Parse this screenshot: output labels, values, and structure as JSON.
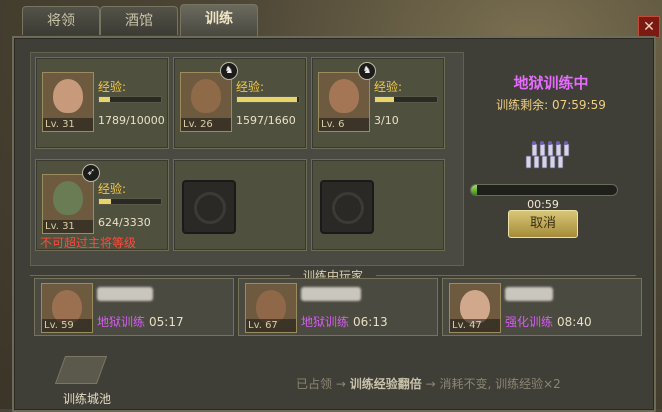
{
  "tabs": [
    {
      "label": "将领"
    },
    {
      "label": "酒馆"
    },
    {
      "label": "训练",
      "active": true
    }
  ],
  "close_icon": "close-icon",
  "slots": [
    {
      "level": "Lv. 31",
      "exp_label": "经验:",
      "exp": "1789/10000",
      "fill": 0.18,
      "icon": null
    },
    {
      "level": "Lv. 26",
      "exp_label": "经验:",
      "exp": "1597/1660",
      "fill": 0.96,
      "icon": "horse-icon"
    },
    {
      "level": "Lv. 6",
      "exp_label": "经验:",
      "exp": "3/10",
      "fill": 0.3,
      "icon": "horse-icon"
    },
    {
      "level": "Lv. 31",
      "exp_label": "经验:",
      "exp": "624/3330",
      "fill": 0.19,
      "icon": "bow-icon",
      "warning": "不可超过主将等级"
    }
  ],
  "training": {
    "title": "地狱训练中",
    "remaining_label": "训练剩余: 07:59:59",
    "progress_time": "00:59",
    "progress": 0.04,
    "cancel_label": "取消"
  },
  "players_heading": "训练中玩家",
  "players": [
    {
      "level": "Lv. 59",
      "mode": "地狱训练",
      "time": "05:17",
      "mode_color": "#d45cf0"
    },
    {
      "level": "Lv. 67",
      "mode": "地狱训练",
      "time": "06:13",
      "mode_color": "#d45cf0"
    },
    {
      "level": "Lv. 47",
      "mode": "强化训练",
      "time": "08:40",
      "mode_color": "#d45cf0"
    }
  ],
  "footer": {
    "castle_label": "训练城池",
    "step1": "已占领",
    "step2": "训练经验翻倍",
    "step3": "消耗不变, 训练经验×2"
  }
}
